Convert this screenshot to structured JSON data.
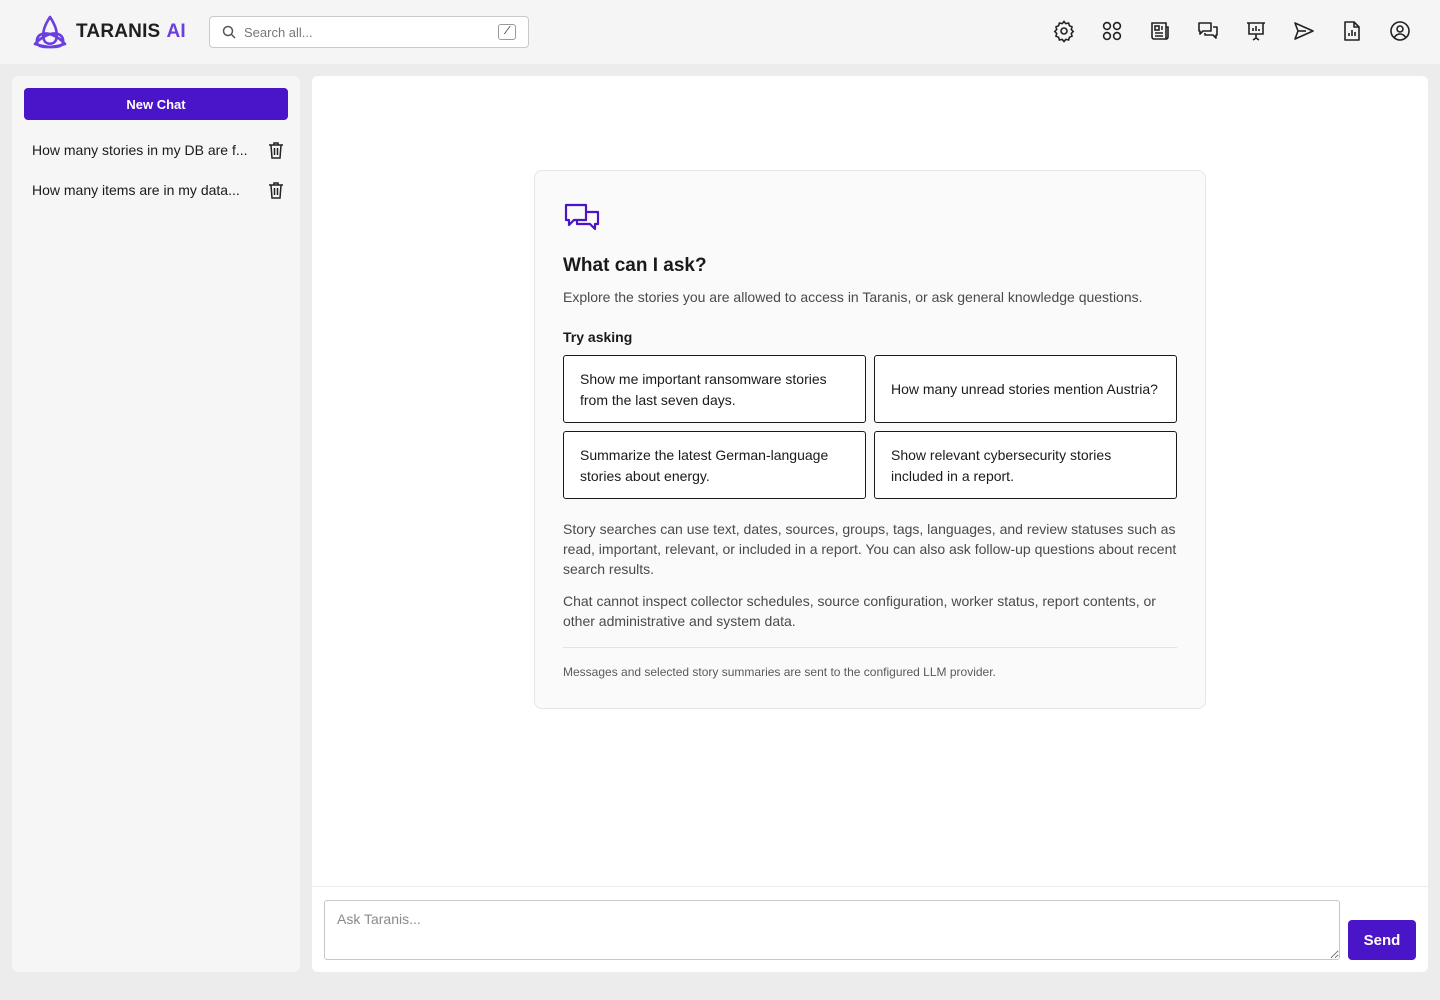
{
  "brand": {
    "name": "TARANIS",
    "suffix": "AI",
    "accent": "#6a3fe0"
  },
  "search": {
    "placeholder": "Search all...",
    "shortcut": "/"
  },
  "nav": {
    "icons": [
      "settings-icon",
      "dashboard-icon",
      "news-icon",
      "chat-icon",
      "presentation-icon",
      "send-icon",
      "report-icon",
      "account-icon"
    ]
  },
  "sidebar": {
    "new_chat_label": "New Chat",
    "chats": [
      {
        "title": "How many stories in my DB are f..."
      },
      {
        "title": "How many items are in my data..."
      }
    ]
  },
  "welcome": {
    "title": "What can I ask?",
    "intro": "Explore the stories you are allowed to access in Taranis, or ask general knowledge questions.",
    "try_label": "Try asking",
    "suggestions": [
      "Show me important ransomware stories from the last seven days.",
      "How many unread stories mention Austria?",
      "Summarize the latest German-language stories about energy.",
      "Show relevant cybersecurity stories included in a report."
    ],
    "para1": "Story searches can use text, dates, sources, groups, tags, languages, and review statuses such as read, important, relevant, or included in a report. You can also ask follow-up questions about recent search results.",
    "para2": "Chat cannot inspect collector schedules, source configuration, worker status, report contents, or other administrative and system data.",
    "footnote": "Messages and selected story summaries are sent to the configured LLM provider."
  },
  "composer": {
    "placeholder": "Ask Taranis...",
    "value": "",
    "send_label": "Send"
  },
  "colors": {
    "primary": "#4a14c9",
    "background": "#ececec"
  }
}
